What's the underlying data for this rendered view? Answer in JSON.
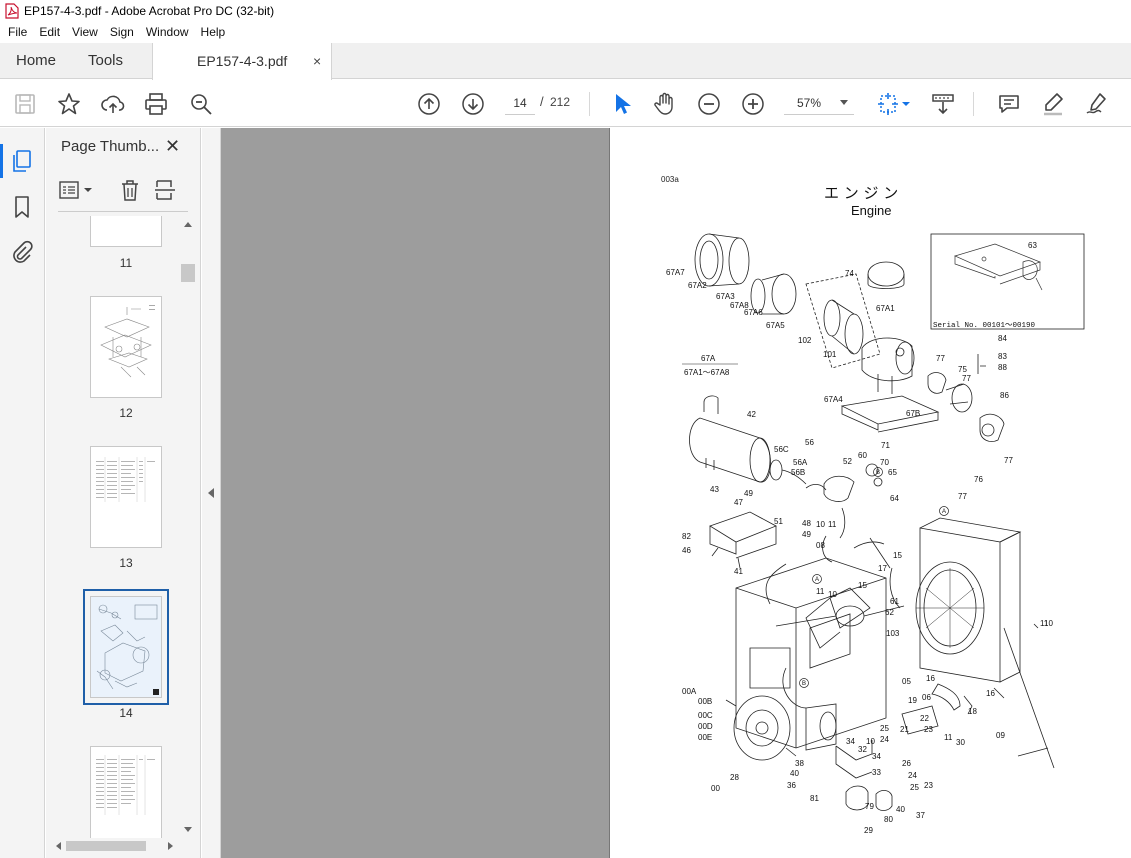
{
  "window": {
    "title": "EP157-4-3.pdf - Adobe Acrobat Pro DC (32-bit)"
  },
  "menu": [
    "File",
    "Edit",
    "View",
    "Sign",
    "Window",
    "Help"
  ],
  "tabs": {
    "home": "Home",
    "tools": "Tools",
    "document": "EP157-4-3.pdf",
    "close": "×"
  },
  "toolbar": {
    "page_current": "14",
    "page_sep": "/",
    "page_total": "212",
    "zoom": "57%"
  },
  "thumbnails_panel": {
    "title": "Page Thumb...",
    "close": "✕",
    "pages": [
      {
        "label": "11",
        "selected": false
      },
      {
        "label": "12",
        "selected": false
      },
      {
        "label": "13",
        "selected": false
      },
      {
        "label": "14",
        "selected": true
      },
      {
        "label": "",
        "selected": false
      }
    ]
  },
  "document": {
    "code": "003a",
    "title_jp": "エ ン ジ ン",
    "title_en": "Engine",
    "serial_note": "Serial No. 00101～00190",
    "subassembly": "67A",
    "subassembly_range": "67A1～67A8",
    "part_labels": [
      "67A7",
      "67A2",
      "67A3",
      "67A8",
      "67A6",
      "67A5",
      "102",
      "101",
      "74",
      "67A1",
      "63",
      "84",
      "83",
      "88",
      "77",
      "75",
      "77",
      "86",
      "67A4",
      "67B",
      "42",
      "56",
      "56C",
      "56A",
      "56B",
      "52",
      "60",
      "71",
      "70",
      "65",
      "64",
      "77",
      "76",
      "77",
      "43",
      "49",
      "47",
      "51",
      "48",
      "49",
      "10",
      "11",
      "08",
      "82",
      "46",
      "41",
      "17",
      "15",
      "15",
      "11",
      "10",
      "61",
      "62",
      "103",
      "11",
      "10",
      "16",
      "05",
      "06",
      "18",
      "16",
      "09",
      "19",
      "21",
      "22",
      "23",
      "25",
      "24",
      "10",
      "11",
      "30",
      "34",
      "32",
      "34",
      "33",
      "26",
      "24",
      "25",
      "23",
      "38",
      "40",
      "36",
      "81",
      "79",
      "40",
      "80",
      "37",
      "29",
      "28",
      "00",
      "00A",
      "00B",
      "00C",
      "00D",
      "00E"
    ]
  },
  "colors": {
    "accent": "#1473e6",
    "workspace": "#9d9d9d",
    "panel": "#f4f4f4"
  }
}
